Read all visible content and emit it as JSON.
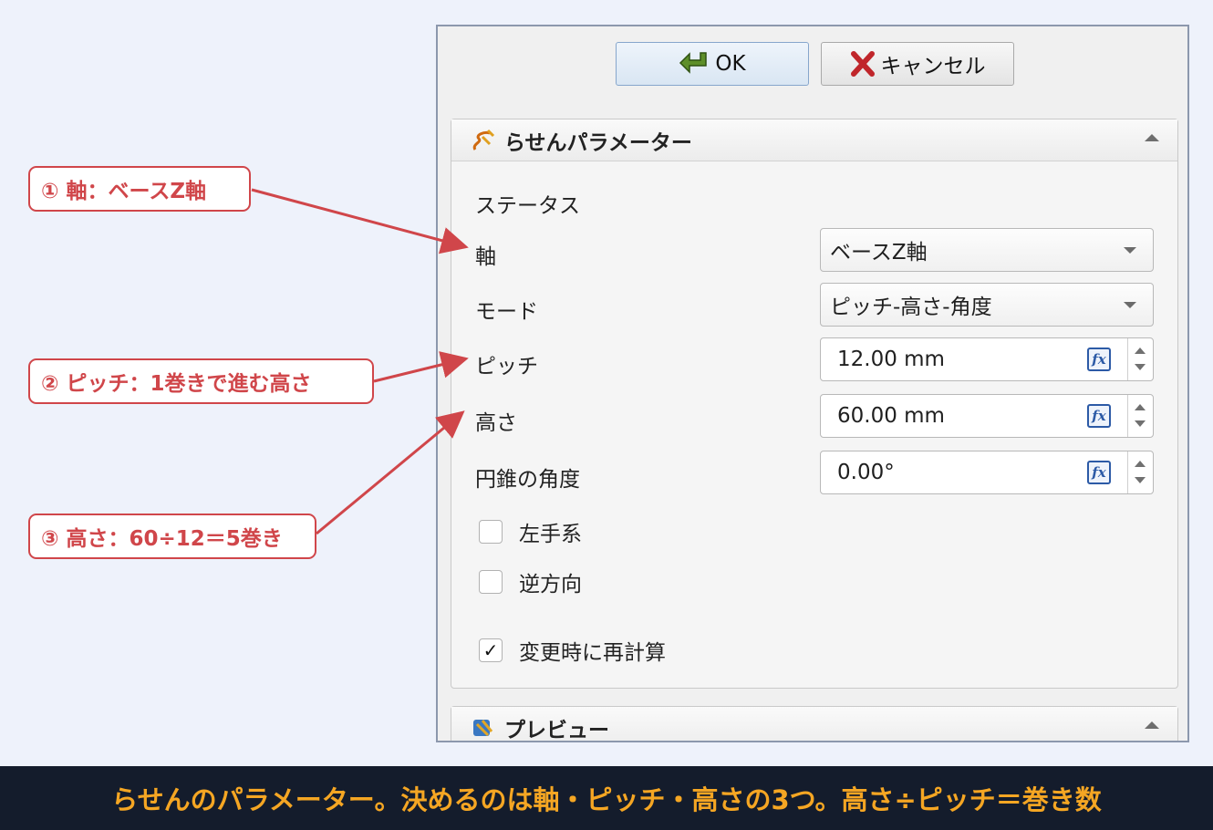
{
  "dialog": {
    "ok_label": "OK",
    "cancel_label": "キャンセル"
  },
  "helix_group": {
    "title": "らせんパラメーター",
    "status_label": "ステータス",
    "axis": {
      "label": "軸",
      "value": "ベースZ軸"
    },
    "mode": {
      "label": "モード",
      "value": "ピッチ-高さ-角度"
    },
    "pitch": {
      "label": "ピッチ",
      "value": "12.00 mm"
    },
    "height": {
      "label": "高さ",
      "value": "60.00 mm"
    },
    "cone_angle": {
      "label": "円錐の角度",
      "value": "0.00°"
    },
    "left_handed": {
      "label": "左手系",
      "checked": false,
      "mark": ""
    },
    "reversed": {
      "label": "逆方向",
      "checked": false,
      "mark": ""
    },
    "recompute": {
      "label": "変更時に再計算",
      "checked": true,
      "mark": "✓"
    },
    "fx_label": "fx"
  },
  "preview_group": {
    "title": "プレビュー"
  },
  "annotations": [
    {
      "text": "① 軸：ベースZ軸"
    },
    {
      "text": "② ピッチ：1巻きで進む高さ"
    },
    {
      "text": "③ 高さ：60÷12＝5巻き"
    }
  ],
  "caption": "らせんのパラメーター。決めるのは軸・ピッチ・高さの3つ。高さ÷ピッチ＝巻き数",
  "colors": {
    "annotation": "#d0464a",
    "caption_text": "#f5a623",
    "caption_bg": "#141c2c",
    "background": "#eef2fb"
  }
}
